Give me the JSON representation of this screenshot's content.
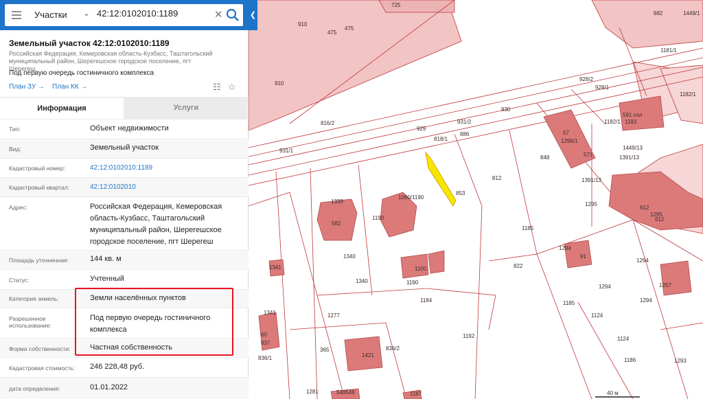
{
  "search": {
    "type_label": "Участки",
    "query": "42:12:0102010:1189"
  },
  "object": {
    "title": "Земельный участок 42:12:0102010:1189",
    "address_line": "Российская Федерация, Кемеровская область-Кузбасс, Таштагольский муниципальный район, Шерегешское городское поселение, пгт Шерегеш",
    "purpose": "Под первую очередь гостиничного комплекса",
    "links": [
      "План ЗУ",
      "План КК"
    ]
  },
  "tabs": [
    "Информация",
    "Услуги"
  ],
  "attributes": [
    {
      "label": "Тип:",
      "value": "Объект недвижимости"
    },
    {
      "label": "Вид:",
      "value": "Земельный участок"
    },
    {
      "label": "Кадастровый номер:",
      "value": "42:12:0102010:1189"
    },
    {
      "label": "Кадастровый квартал:",
      "value": "42:12:0102010"
    },
    {
      "label": "Адрес:",
      "value": "Российская Федерация, Кемеровская область-Кузбасс, Таштагольский муниципальный район, Шерегешское городское поселение, пгт Шерегеш"
    },
    {
      "label": "Площадь уточненная:",
      "value": "144 кв. м"
    },
    {
      "label": "Статус:",
      "value": "Учтенный"
    },
    {
      "label": "Категория земель:",
      "value": "Земли населённых пунктов"
    },
    {
      "label": "Разрешенное использование:",
      "value": "Под первую очередь гостиничного комплекса"
    },
    {
      "label": "Форма собственности:",
      "value": "Частная собственность"
    },
    {
      "label": "Кадастровая стоимость:",
      "value": "246 228,48 руб."
    },
    {
      "label": "дата определения:",
      "value": "01.01.2022"
    }
  ],
  "map": {
    "scale_label": "40 м",
    "colors": {
      "parcel_fill": "#f2c4c4",
      "building_fill": "#dc7a7a",
      "line": "#c0363a",
      "selected": "#f7e600"
    },
    "labels": [
      "725",
      "910",
      "910",
      "682",
      "1449/1",
      "475",
      "475",
      "1181/1",
      "928/2",
      "928/1",
      "1182/1",
      "930",
      "816/2",
      "931/2",
      "929",
      "818/1",
      "886",
      "591 сол",
      "1183",
      "931/1",
      "57",
      "1296/1",
      "1182/1",
      "571",
      "1449/13",
      "1391/13",
      "848",
      "812",
      "853",
      "1339",
      "582",
      "1090/1190",
      "1190",
      "1391/13",
      "1295",
      "612",
      "1295",
      "612",
      "1185",
      "1340",
      "1100",
      "1190",
      "1294",
      "91",
      "822",
      "1294",
      "1341",
      "1340",
      "1294",
      "1294",
      "1184",
      "1185",
      "1277",
      "1124",
      "1257",
      "1341",
      "1192",
      "1124",
      "365",
      "1421",
      "836/2",
      "60",
      "1186",
      "1293",
      "836/1",
      "837",
      "1281",
      "1187",
      "548548"
    ]
  }
}
